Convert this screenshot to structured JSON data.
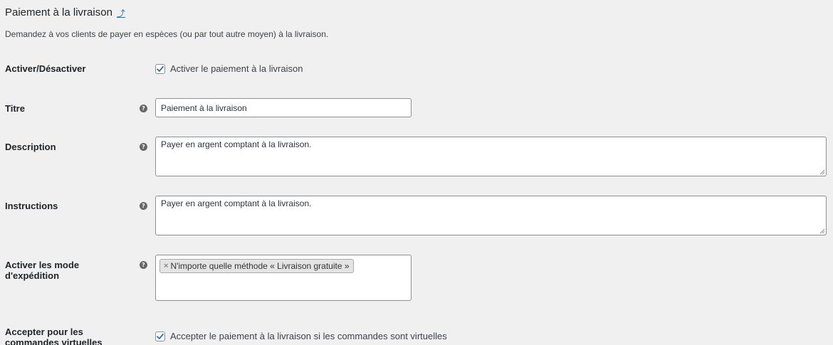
{
  "page": {
    "title": "Paiement à la livraison",
    "back_link": "⤴",
    "description": "Demandez à vos clients de payer en espèces (ou par tout autre moyen) à la livraison."
  },
  "fields": {
    "enable": {
      "label": "Activer/Désactiver",
      "checkbox_label": "Activer le paiement à la livraison",
      "checked": true
    },
    "title": {
      "label": "Titre",
      "help": "?",
      "value": "Paiement à la livraison"
    },
    "description": {
      "label": "Description",
      "help": "?",
      "value": "Payer en argent comptant à la livraison."
    },
    "instructions": {
      "label": "Instructions",
      "help": "?",
      "value": "Payer en argent comptant à la livraison."
    },
    "shipping_methods": {
      "label": "Activer les mode d'expédition",
      "help": "?",
      "tokens": [
        {
          "remove": "×",
          "text": "N'importe quelle méthode « Livraison gratuite »"
        }
      ]
    },
    "virtual": {
      "label": "Accepter pour les commandes virtuelles",
      "checkbox_label": "Accepter le paiement à la livraison si les commandes sont virtuelles",
      "checked": true
    }
  },
  "colors": {
    "background": "#f0f0f1",
    "accent": "#2271b1",
    "border": "#8c8f94"
  }
}
